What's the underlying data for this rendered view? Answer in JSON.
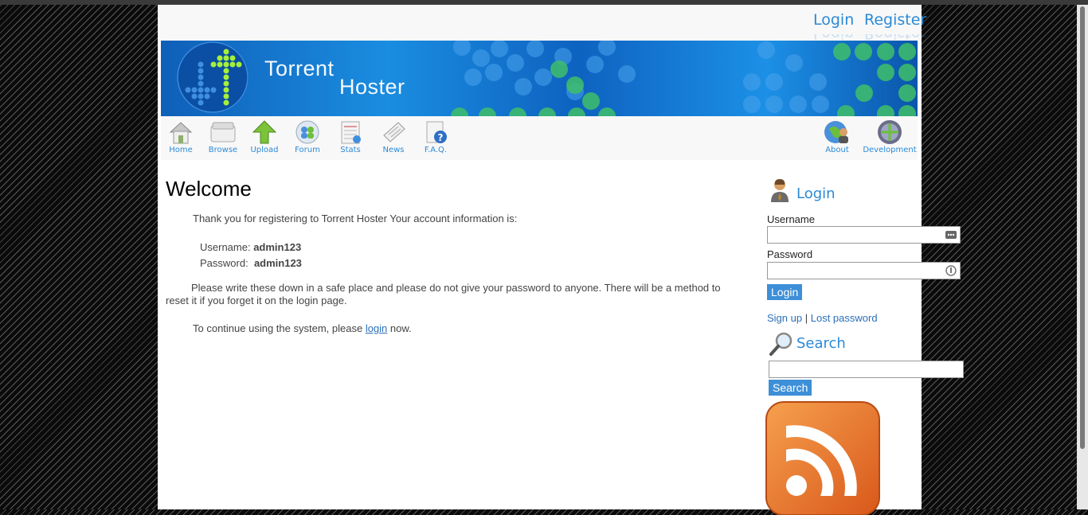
{
  "header": {
    "login_link": "Login",
    "register_link": "Register"
  },
  "banner": {
    "brand_line1": "Torrent",
    "brand_line2": "Hoster"
  },
  "nav": {
    "left": [
      {
        "label": "Home",
        "icon": "home-icon"
      },
      {
        "label": "Browse",
        "icon": "browse-icon"
      },
      {
        "label": "Upload",
        "icon": "upload-icon"
      },
      {
        "label": "Forum",
        "icon": "forum-icon"
      },
      {
        "label": "Stats",
        "icon": "stats-icon"
      },
      {
        "label": "News",
        "icon": "news-icon"
      },
      {
        "label": "F.A.Q.",
        "icon": "faq-icon"
      }
    ],
    "right": [
      {
        "label": "About",
        "icon": "about-icon"
      },
      {
        "label": "Development",
        "icon": "development-icon"
      }
    ]
  },
  "main": {
    "title": "Welcome",
    "intro": "Thank you for registering to Torrent Hoster Your account information is:",
    "username_label": "Username:",
    "username_value": "admin123",
    "password_label": "Password:",
    "password_value": "admin123",
    "notice": "Please write these down in a safe place and please do not give your password to anyone. There will be a method to reset it if you forget it on the login page.",
    "continue_prefix": "To continue using the system, please",
    "continue_link": "login",
    "continue_suffix": "now."
  },
  "sidebar": {
    "login_title": "Login",
    "username_label": "Username",
    "username_value": "",
    "password_label": "Password",
    "password_value": "",
    "login_button": "Login",
    "signup_link": "Sign up",
    "separator": "|",
    "lost_password_link": "Lost password",
    "search_title": "Search",
    "search_value": "",
    "search_button": "Search"
  },
  "colors": {
    "link": "#2b8ad8",
    "button": "#3d8fd8",
    "banner_blue": "#1a8de0",
    "rss_orange": "#ef7d25"
  }
}
